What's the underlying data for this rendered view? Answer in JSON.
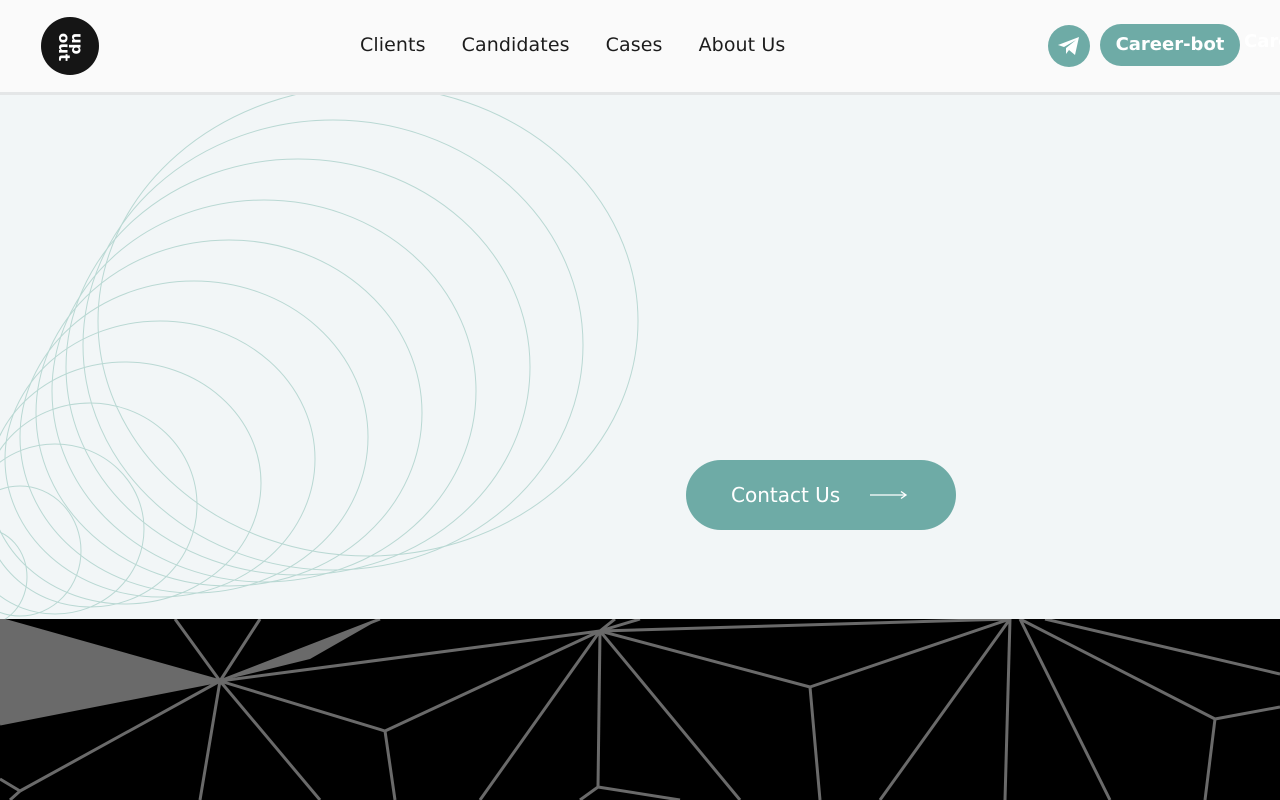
{
  "header": {
    "logo_text": "up & out",
    "nav": [
      "Clients",
      "Candidates",
      "Cases",
      "About Us"
    ],
    "telegram_icon": "paper-plane-icon",
    "career_bot_label": "Career-bot",
    "career_bot_overflow_text": "Career-bot"
  },
  "hero": {
    "contact_label": "Contact Us",
    "contact_icon": "long-arrow-right-icon"
  },
  "colors": {
    "accent": "#6eaba6",
    "hero_bg": "#f2f6f7",
    "header_bg": "#fafafa",
    "dark": "#151515",
    "circle_stroke": "#b9d8d3"
  }
}
